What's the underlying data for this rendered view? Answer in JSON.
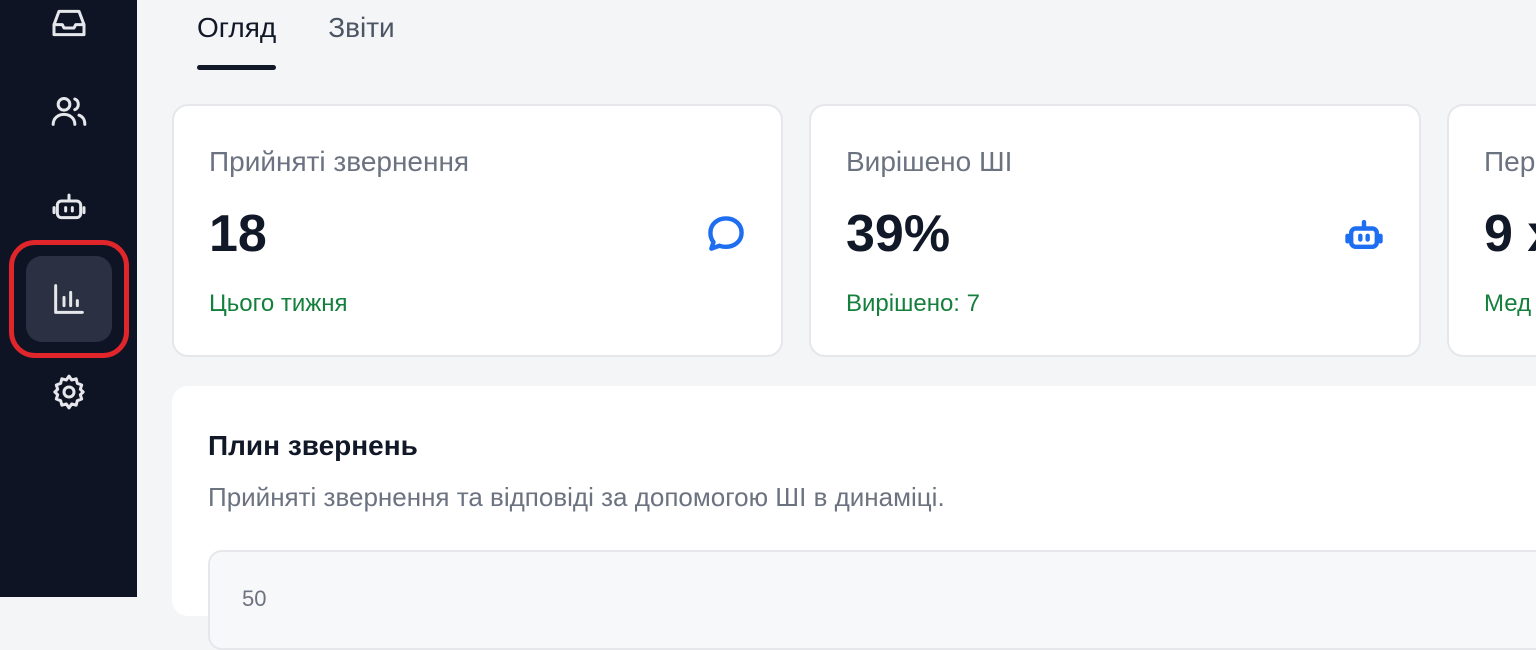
{
  "tabs": [
    {
      "label": "Огляд",
      "active": true
    },
    {
      "label": "Звіти",
      "active": false
    }
  ],
  "sidebar": {
    "items": [
      {
        "icon": "inbox-icon"
      },
      {
        "icon": "users-icon"
      },
      {
        "icon": "bot-icon"
      },
      {
        "icon": "bar-chart-icon",
        "active": true
      },
      {
        "icon": "gear-icon"
      }
    ]
  },
  "cards": [
    {
      "title": "Прийняті звернення",
      "value": "18",
      "sub": "Цього тижня",
      "icon": "chat-bubble-icon"
    },
    {
      "title": "Вирішено ШІ",
      "value": "39%",
      "sub": "Вирішено: 7",
      "icon": "bot-icon"
    },
    {
      "title": "Пер",
      "value": "9 х",
      "sub": "Мед"
    }
  ],
  "panel": {
    "title": "Плин звернень",
    "subtitle": "Прийняті звернення та відповіді за допомогою ШІ в динаміці.",
    "y_tick": "50"
  },
  "colors": {
    "sidebar_bg": "#0f1425",
    "accent_blue": "#1d6ef0",
    "positive_green": "#15803d",
    "highlight_red": "#e0262b"
  }
}
